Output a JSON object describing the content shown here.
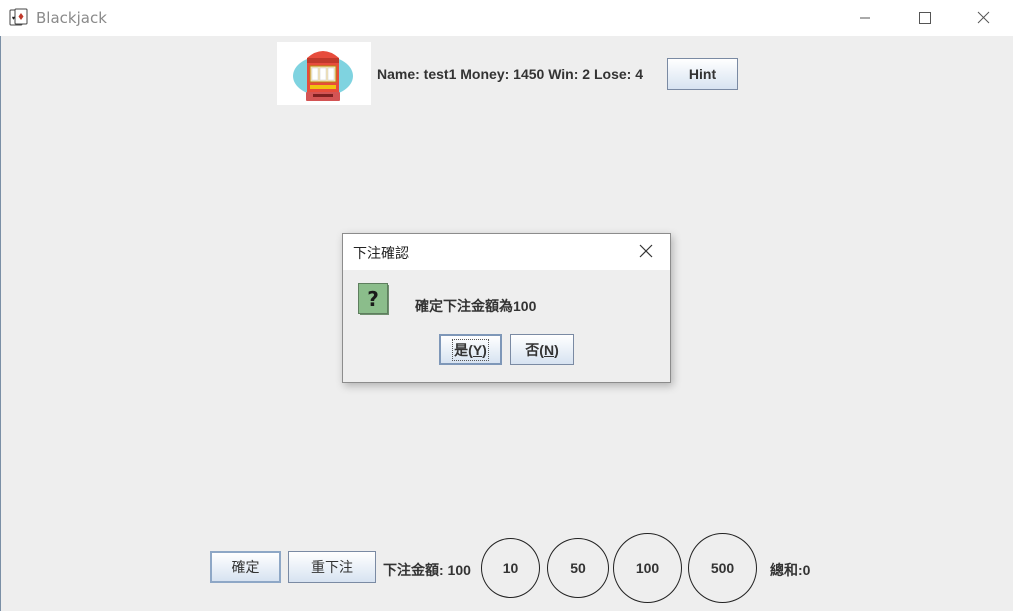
{
  "window": {
    "title": "Blackjack"
  },
  "player": {
    "name_label": "Name: test1",
    "money_label": "Money: 1450",
    "win_label": "Win: 2",
    "lose_label": "Lose: 4"
  },
  "hint_button": "Hint",
  "dialog": {
    "title": "下注確認",
    "message": "確定下注金額為100",
    "yes_text": "是(",
    "yes_mnemonic": "Y",
    "yes_close": ")",
    "no_text": "否(",
    "no_mnemonic": "N",
    "no_close": ")"
  },
  "bottom": {
    "confirm_label": "確定",
    "rebet_label": "重下注",
    "bet_amount_label": "下注金額: 100",
    "chips": [
      "10",
      "50",
      "100",
      "500"
    ],
    "total_label": "總和:0"
  },
  "icons": {
    "app": "playing-cards-icon",
    "avatar": "slot-machine-icon",
    "dialog": "question-icon"
  },
  "colors": {
    "background": "#eeeeee",
    "button_gradient_bottom": "#d7e3f1",
    "question_icon_green": "#8bbd8b"
  }
}
